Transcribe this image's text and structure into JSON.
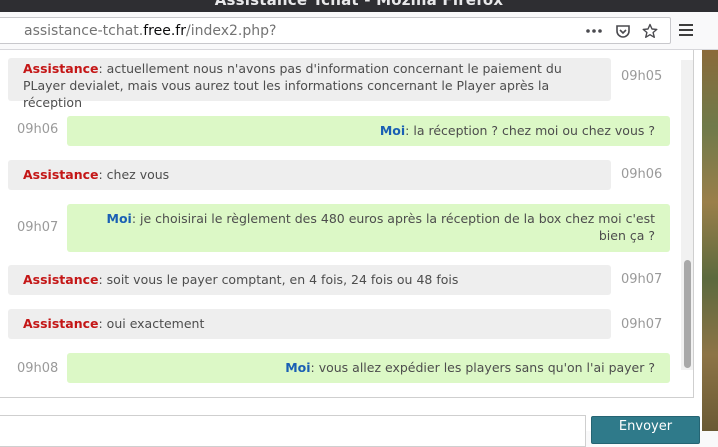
{
  "window": {
    "title": "Assistance Tchat - Mozilla Firefox"
  },
  "browser": {
    "url_prefix": "assistance-tchat.",
    "url_domain": "free.fr",
    "url_path": "/index2.php?",
    "icons": [
      "page-actions-icon",
      "pocket-icon",
      "bookmark-star-icon",
      "hamburger-menu-icon"
    ]
  },
  "chat": {
    "messages": [
      {
        "sender": "Assistance",
        "text": "actuellement nous n'avons pas d'information concernant le paiement du PLayer devialet, mais vous aurez tout les informations concernant le Player après la réception",
        "time": "09h05"
      },
      {
        "sender": "Moi",
        "text": "la réception ? chez moi ou chez vous ?",
        "time": "09h06"
      },
      {
        "sender": "Assistance",
        "text": "chez vous",
        "time": "09h06"
      },
      {
        "sender": "Moi",
        "text": "je choisirai le règlement des 480 euros après la réception de la box chez moi c'est bien ça ?",
        "time": "09h07"
      },
      {
        "sender": "Assistance",
        "text": "soit vous le payer comptant, en 4 fois, 24 fois ou 48 fois",
        "time": "09h07"
      },
      {
        "sender": "Assistance",
        "text": "oui exactement",
        "time": "09h07"
      },
      {
        "sender": "Moi",
        "text": "vous allez expédier les players sans qu'on l'ai payer ?",
        "time": "09h08"
      }
    ],
    "send_label": "Envoyer",
    "colors": {
      "assistance_bubble": "#eeeeee",
      "moi_bubble": "#dcf8c6",
      "assistance_name": "#c41616",
      "moi_name": "#1a5fb4"
    }
  }
}
